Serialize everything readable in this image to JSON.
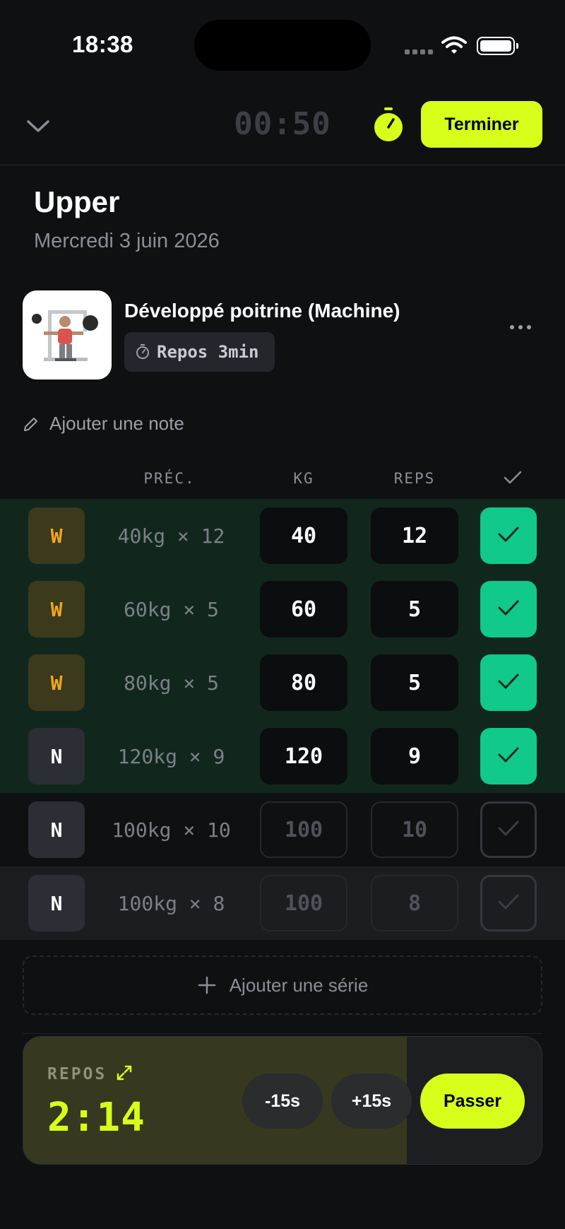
{
  "status_bar": {
    "time": "18:38"
  },
  "top_bar": {
    "elapsed": "00:50",
    "finish_label": "Terminer"
  },
  "workout": {
    "title": "Upper",
    "date": "Mercredi 3 juin 2026"
  },
  "exercise": {
    "name": "Développé poitrine (Machine)",
    "rest_label": "Repos 3min",
    "note_placeholder": "Ajouter une note"
  },
  "table": {
    "headers": {
      "prev": "PRÉC.",
      "kg": "KG",
      "reps": "REPS"
    },
    "rows": [
      {
        "type": "W",
        "prev": "40kg × 12",
        "kg": "40",
        "reps": "12",
        "done": true
      },
      {
        "type": "W",
        "prev": "60kg × 5",
        "kg": "60",
        "reps": "5",
        "done": true
      },
      {
        "type": "W",
        "prev": "80kg × 5",
        "kg": "80",
        "reps": "5",
        "done": true
      },
      {
        "type": "N",
        "prev": "120kg × 9",
        "kg": "120",
        "reps": "9",
        "done": true
      },
      {
        "type": "N",
        "prev": "100kg × 10",
        "kg": "100",
        "reps": "10",
        "done": false
      },
      {
        "type": "N",
        "prev": "100kg × 8",
        "kg": "100",
        "reps": "8",
        "done": false
      }
    ]
  },
  "add_set_label": "Ajouter une série",
  "rest_timer": {
    "label": "REPOS",
    "time": "2:14",
    "progress_fraction": 0.74,
    "minus_label": "-15s",
    "plus_label": "+15s",
    "skip_label": "Passer"
  },
  "colors": {
    "accent": "#d7ff1a",
    "done_green": "#10c98a",
    "warmup_orange": "#f1a81c"
  }
}
